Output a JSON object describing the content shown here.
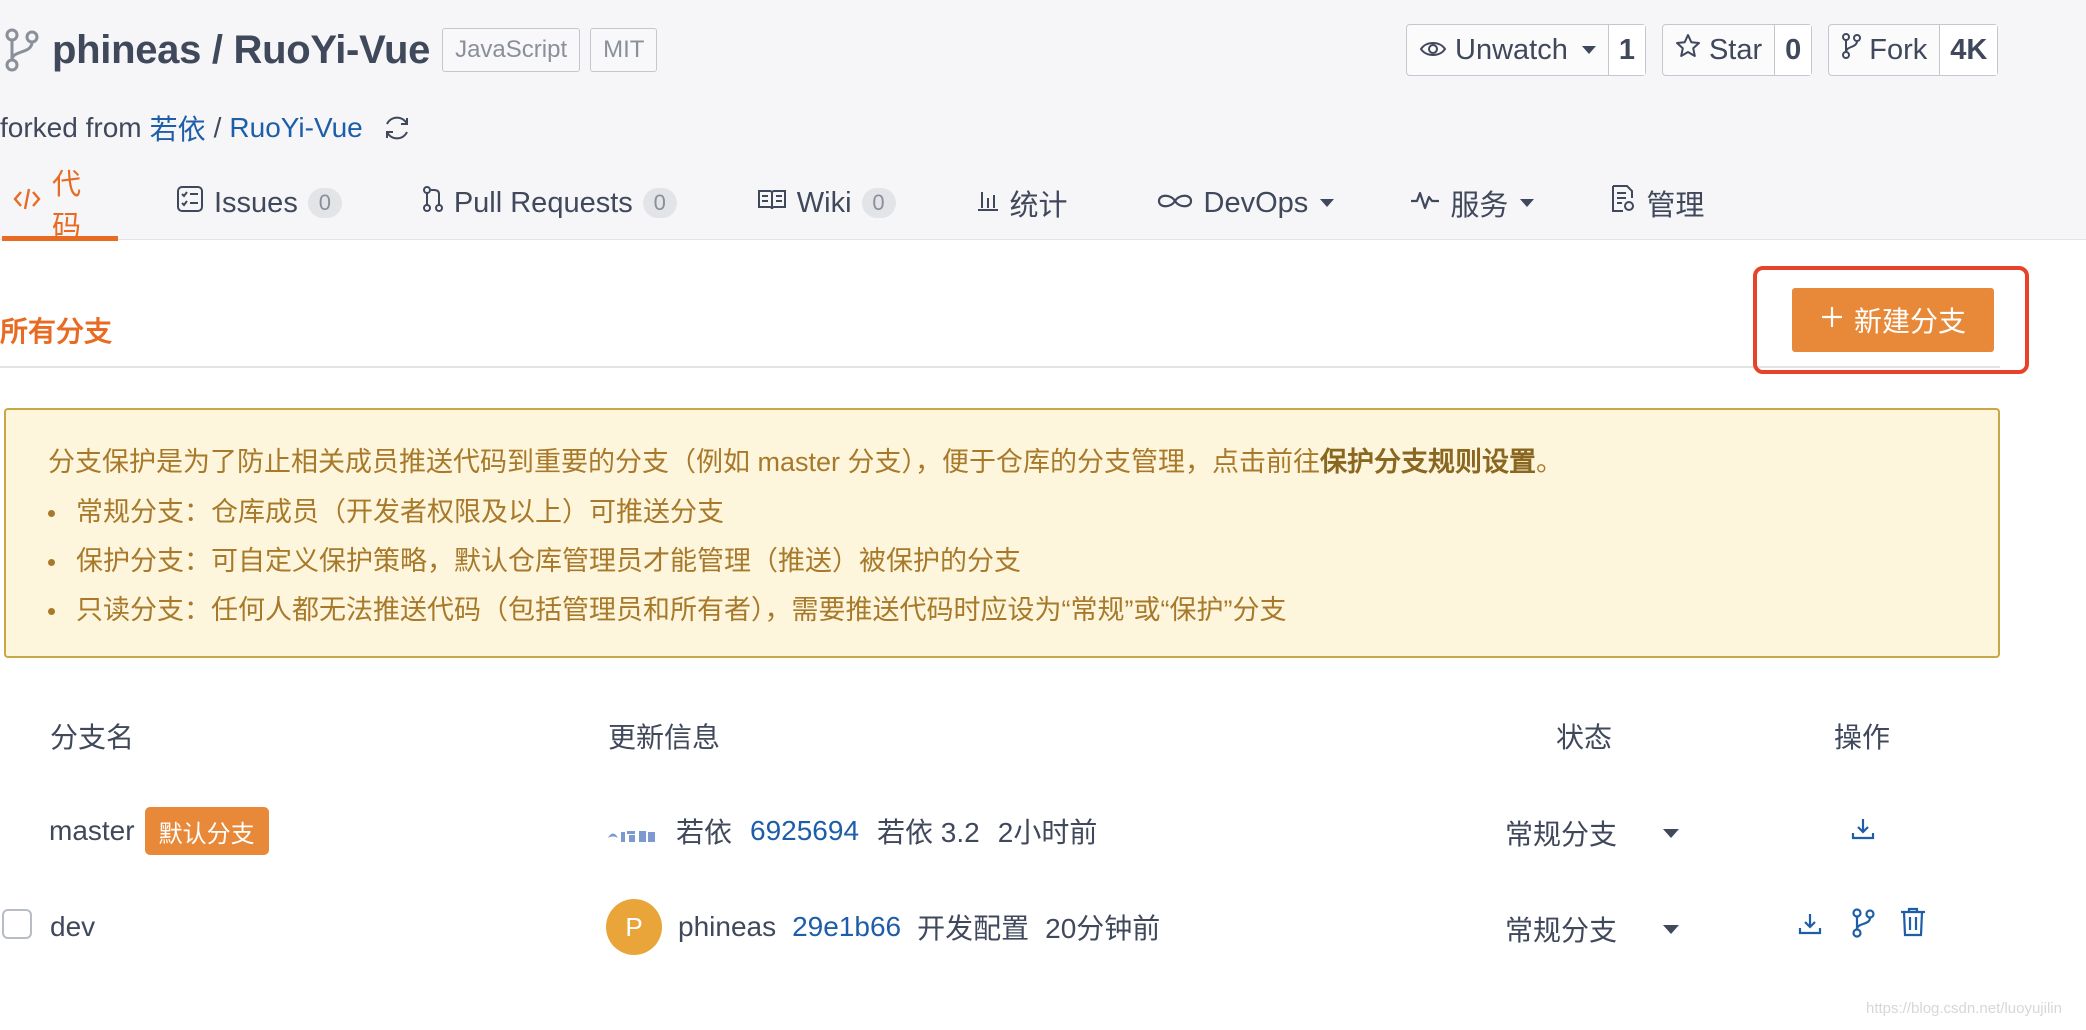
{
  "repo": {
    "owner": "phineas",
    "separator": "/",
    "name": "RuoYi-Vue",
    "title": "phineas / RuoYi-Vue",
    "language_tag": "JavaScript",
    "license_tag": "MIT",
    "forked_prefix": "forked from",
    "forked_owner": "若依",
    "forked_sep": "/",
    "forked_repo": "RuoYi-Vue"
  },
  "actions": {
    "watch_label": "Unwatch",
    "watch_count": "1",
    "star_label": "Star",
    "star_count": "0",
    "fork_label": "Fork",
    "fork_count": "4K"
  },
  "tabs": [
    {
      "label": "代码"
    },
    {
      "label": "Issues",
      "count": "0"
    },
    {
      "label": "Pull Requests",
      "count": "0"
    },
    {
      "label": "Wiki",
      "count": "0"
    },
    {
      "label": "统计"
    },
    {
      "label": "DevOps"
    },
    {
      "label": "服务"
    },
    {
      "label": "管理"
    }
  ],
  "section": {
    "title": "所有分支",
    "new_branch_label": "新建分支"
  },
  "notice": {
    "lead": "分支保护是为了防止相关成员推送代码到重要的分支（例如 master 分支），便于仓库的分支管理，点击前往",
    "lead_link": "保护分支规则设置",
    "lead_end": "。",
    "items": [
      "常规分支：仓库成员（开发者权限及以上）可推送分支",
      "保护分支：可自定义保护策略，默认仓库管理员才能管理（推送）被保护的分支",
      "只读分支：任何人都无法推送代码（包括管理员和所有者），需要推送代码时应设为“常规”或“保护”分支"
    ]
  },
  "table": {
    "headers": {
      "name": "分支名",
      "update": "更新信息",
      "status": "状态",
      "ops": "操作"
    },
    "rows": [
      {
        "branch": "master",
        "badge": "默认分支",
        "avatar_text": "",
        "author": "若依",
        "sha": "6925694",
        "message": "若依 3.2",
        "time": "2小时前",
        "status": "常规分支"
      },
      {
        "branch": "dev",
        "avatar_text": "P",
        "author": "phineas",
        "sha": "29e1b66",
        "message": "开发配置",
        "time": "20分钟前",
        "status": "常规分支"
      }
    ]
  },
  "watermark": "https://blog.csdn.net/luoyujilin",
  "colors": {
    "accent": "#e86b24",
    "button": "#e8893a",
    "highlight": "#e8432a",
    "link": "#1e5ea8",
    "notice_bg": "#fdf6dc"
  }
}
